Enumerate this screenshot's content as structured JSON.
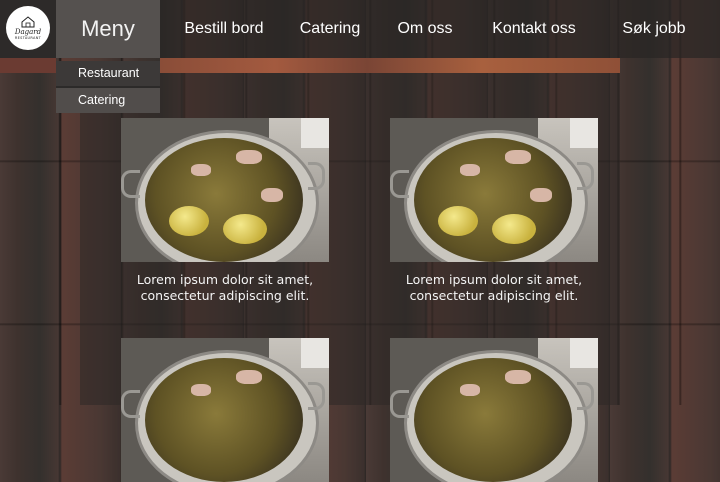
{
  "logo": {
    "brand": "Dagard",
    "sub": "RESTAURANT"
  },
  "nav": {
    "menu_label": "Meny",
    "items": [
      "Bestill bord",
      "Catering",
      "Om oss",
      "Kontakt oss",
      "Søk jobb"
    ]
  },
  "dropdown": {
    "items": [
      "Restaurant",
      "Catering"
    ]
  },
  "cards": [
    {
      "caption_line1": "Lorem ipsum dolor sit amet,",
      "caption_line2": "consectetur adipiscing elit."
    },
    {
      "caption_line1": "Lorem ipsum dolor sit amet,",
      "caption_line2": "consectetur adipiscing elit."
    },
    {
      "caption_line1": "",
      "caption_line2": ""
    },
    {
      "caption_line1": "",
      "caption_line2": ""
    }
  ],
  "colors": {
    "nav_bg": "#2d2a29",
    "menu_active": "#55514f",
    "accent_strip": "#a35a3f"
  }
}
